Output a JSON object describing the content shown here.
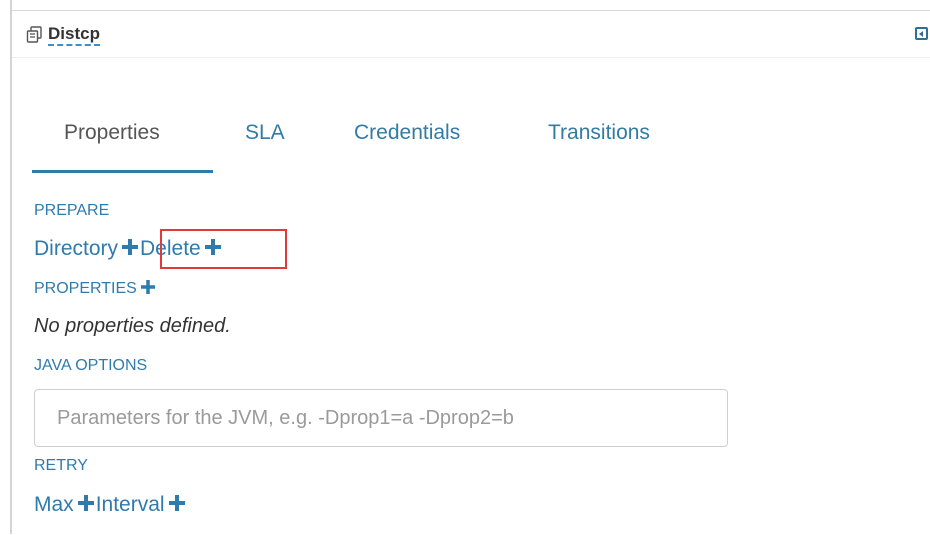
{
  "header": {
    "title": "Distcp"
  },
  "tabs": [
    {
      "label": "Properties",
      "active": true
    },
    {
      "label": "SLA",
      "active": false
    },
    {
      "label": "Credentials",
      "active": false
    },
    {
      "label": "Transitions",
      "active": false
    }
  ],
  "prepare": {
    "heading": "PREPARE",
    "directory_label": "Directory",
    "delete_label": "Delete"
  },
  "properties": {
    "heading": "PROPERTIES",
    "empty_text": "No properties defined."
  },
  "java_options": {
    "heading": "JAVA OPTIONS",
    "placeholder": "Parameters for the JVM, e.g. -Dprop1=a -Dprop2=b",
    "value": ""
  },
  "retry": {
    "heading": "RETRY",
    "max_label": "Max",
    "interval_label": "Interval"
  },
  "colors": {
    "accent": "#2f7bad",
    "highlight": "#e23a3a"
  },
  "icons": {
    "title": "copy-icon",
    "collapse": "collapse-panel-icon",
    "add": "plus-icon"
  }
}
